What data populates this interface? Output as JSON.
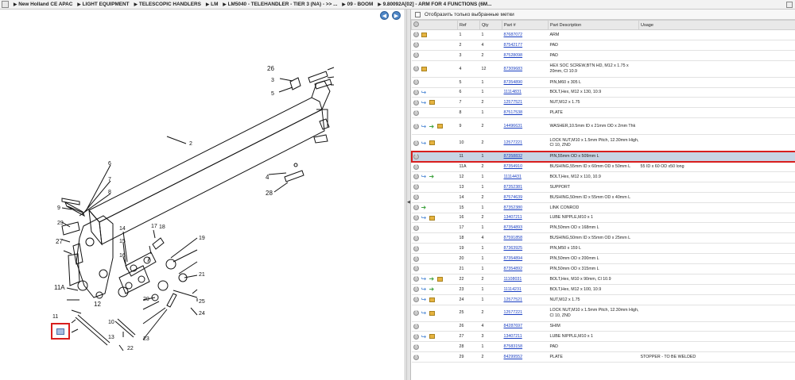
{
  "breadcrumb": [
    "New Holland CE APAC",
    "LIGHT EQUIPMENT",
    "TELESCOPIC HANDLERS",
    "LM",
    "LM5040 - TELEHANDLER - TIER 3 (NA) - >> ...",
    "09 - BOOM",
    "9.80092A[02] - ARM FOR 4 FUNCTIONS (6M..."
  ],
  "filter": {
    "label": "Отобразить только выбранные метки"
  },
  "table": {
    "headers": [
      "Ref",
      "Qty",
      "Part #",
      "Part Description",
      "Usage"
    ],
    "rows": [
      {
        "icons": [
          "box"
        ],
        "ref": "1",
        "qty": "1",
        "part": "87687072",
        "desc": "ARM",
        "usage": ""
      },
      {
        "icons": [],
        "ref": "2",
        "qty": "4",
        "part": "87542177",
        "desc": "PAD",
        "usage": ""
      },
      {
        "icons": [],
        "ref": "3",
        "qty": "2",
        "part": "87528098",
        "desc": "PAD",
        "usage": ""
      },
      {
        "icons": [
          "box"
        ],
        "ref": "4",
        "qty": "12",
        "part": "87309683",
        "desc": "HEX SOC SCREW,BTN HD, M12 x 1.75 x 20mm, Cl 10.9",
        "usage": "",
        "tall": true
      },
      {
        "icons": [],
        "ref": "5",
        "qty": "1",
        "part": "87354890",
        "desc": "PIN,M60 x 305 L",
        "usage": ""
      },
      {
        "icons": [
          "return"
        ],
        "ref": "6",
        "qty": "1",
        "part": "11114831",
        "desc": "BOLT,Hex, M12 x 130, 10.9",
        "usage": ""
      },
      {
        "icons": [
          "return",
          "box"
        ],
        "ref": "7",
        "qty": "2",
        "part": "12577521",
        "desc": "NUT,M12 x 1.75",
        "usage": ""
      },
      {
        "icons": [],
        "ref": "8",
        "qty": "1",
        "part": "87517538",
        "desc": "PLATE",
        "usage": ""
      },
      {
        "icons": [
          "return",
          "fwd",
          "box"
        ],
        "ref": "9",
        "qty": "2",
        "part": "14496631",
        "desc": "WASHER,10.5mm ID x 21mm OD x 2mm Thk",
        "usage": "",
        "tall": true
      },
      {
        "icons": [
          "return",
          "box"
        ],
        "ref": "10",
        "qty": "2",
        "part": "12577221",
        "desc": "LOCK NUT,M10 x 1.5mm Pitch, 12.30mm High, Cl 10, ZND",
        "usage": "",
        "tall": true
      },
      {
        "icons": [],
        "ref": "11",
        "qty": "1",
        "part": "87358832",
        "desc": "PIN,55mm OD x 509mm L",
        "usage": "",
        "selected": true
      },
      {
        "icons": [],
        "ref": "11A",
        "qty": "2",
        "part": "87354910",
        "desc": "BUSHING,55mm ID x 60mm OD x 50mm L",
        "usage": "55 ID x 60 OD x50 long"
      },
      {
        "icons": [
          "return",
          "fwd"
        ],
        "ref": "12",
        "qty": "1",
        "part": "11114431",
        "desc": "BOLT,Hex, M12 x 110, 10.9",
        "usage": ""
      },
      {
        "icons": [],
        "ref": "13",
        "qty": "1",
        "part": "87352381",
        "desc": "SUPPORT",
        "usage": ""
      },
      {
        "icons": [],
        "ref": "14",
        "qty": "2",
        "part": "87574639",
        "desc": "BUSHING,50mm ID x 55mm OD x 40mm L",
        "usage": ""
      },
      {
        "icons": [
          "fwd"
        ],
        "ref": "15",
        "qty": "1",
        "part": "87352380",
        "desc": "LINK CONROD",
        "usage": ""
      },
      {
        "icons": [
          "return",
          "box"
        ],
        "ref": "16",
        "qty": "2",
        "part": "13407211",
        "desc": "LUBE NIPPLE,M10 x 1",
        "usage": ""
      },
      {
        "icons": [],
        "ref": "17",
        "qty": "1",
        "part": "87354893",
        "desc": "PIN,50mm OD x 168mm L",
        "usage": ""
      },
      {
        "icons": [],
        "ref": "18",
        "qty": "4",
        "part": "87591858",
        "desc": "BUSHING,50mm ID x 55mm OD x 25mm L",
        "usage": ""
      },
      {
        "icons": [],
        "ref": "19",
        "qty": "1",
        "part": "87363925",
        "desc": "PIN,M50 x 159 L",
        "usage": ""
      },
      {
        "icons": [],
        "ref": "20",
        "qty": "1",
        "part": "87354894",
        "desc": "PIN,50mm OD x 200mm L",
        "usage": ""
      },
      {
        "icons": [],
        "ref": "21",
        "qty": "1",
        "part": "87354892",
        "desc": "PIN,50mm OD x 315mm L",
        "usage": ""
      },
      {
        "icons": [
          "return",
          "fwd",
          "box"
        ],
        "ref": "22",
        "qty": "2",
        "part": "11108031",
        "desc": "BOLT,Hex, M10 x 90mm, Cl 10.9",
        "usage": ""
      },
      {
        "icons": [
          "return",
          "fwd"
        ],
        "ref": "23",
        "qty": "1",
        "part": "11114231",
        "desc": "BOLT,Hex, M12 x 100, 10.9",
        "usage": ""
      },
      {
        "icons": [
          "return",
          "box"
        ],
        "ref": "24",
        "qty": "1",
        "part": "12577521",
        "desc": "NUT,M12 x 1.75",
        "usage": ""
      },
      {
        "icons": [
          "return",
          "box"
        ],
        "ref": "25",
        "qty": "2",
        "part": "12577221",
        "desc": "LOCK NUT,M10 x 1.5mm Pitch, 12.30mm High, Cl 10, ZND",
        "usage": "",
        "tall": true
      },
      {
        "icons": [],
        "ref": "26",
        "qty": "4",
        "part": "84287697",
        "desc": "SHIM",
        "usage": ""
      },
      {
        "icons": [
          "return",
          "box"
        ],
        "ref": "27",
        "qty": "3",
        "part": "13407211",
        "desc": "LUBE NIPPLE,M10 x 1",
        "usage": ""
      },
      {
        "icons": [],
        "ref": "28",
        "qty": "1",
        "part": "87583158",
        "desc": "PAD",
        "usage": ""
      },
      {
        "icons": [],
        "ref": "29",
        "qty": "2",
        "part": "84299552",
        "desc": "PLATE",
        "usage": "STOPPER - TO BE WELDED"
      }
    ]
  },
  "diagram_labels": [
    "26",
    "4",
    "28",
    "1",
    "2",
    "3",
    "5",
    "6",
    "7",
    "8",
    "9",
    "29",
    "27",
    "11A",
    "12",
    "11",
    "10",
    "13",
    "14",
    "15",
    "16",
    "17",
    "18",
    "19",
    "20",
    "21",
    "22",
    "23",
    "24",
    "25"
  ],
  "colors": {
    "link": "#1a3fc2",
    "selected_row": "#c7d4e4",
    "highlight_border": "#d81e1e",
    "nav_button": "#4e86c6"
  }
}
